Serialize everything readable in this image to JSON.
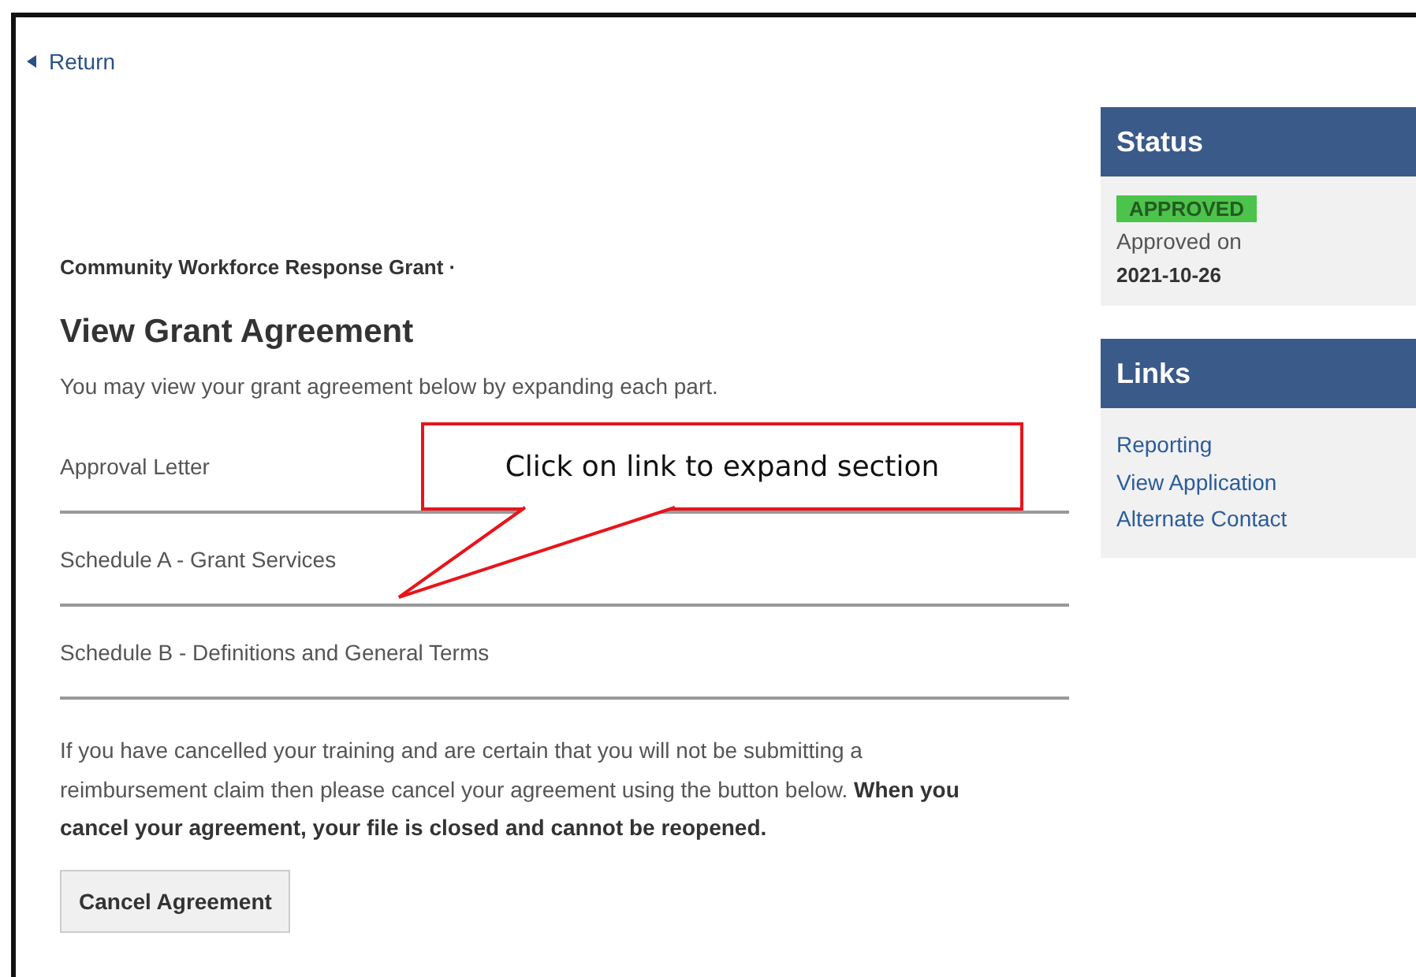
{
  "back_link": {
    "label": "Return"
  },
  "program": "Community Workforce Response Grant ·",
  "title": "View Grant Agreement",
  "intro": "You may view your grant agreement below by expanding each part.",
  "sections": [
    {
      "label": "Approval Letter"
    },
    {
      "label": "Schedule A - Grant Services"
    },
    {
      "label": "Schedule B - Definitions and General Terms"
    }
  ],
  "notice": "If you have cancelled your training and are certain that you will not be submitting a reimbursement claim then please cancel your agreement using the button below. **When you cancel your agreement, your file is closed and cannot be reopened.**",
  "cancel_button": "Cancel Agreement",
  "status": {
    "heading": "Status",
    "badge": {
      "label": "APPROVED",
      "color": "#4cc34a"
    },
    "label": "Approved on",
    "date": "2021-10-26"
  },
  "links": {
    "heading": "Links",
    "items": [
      "Reporting",
      "View Application",
      "Alternate Contact"
    ]
  },
  "callout": {
    "text": "Click on link to expand section"
  }
}
